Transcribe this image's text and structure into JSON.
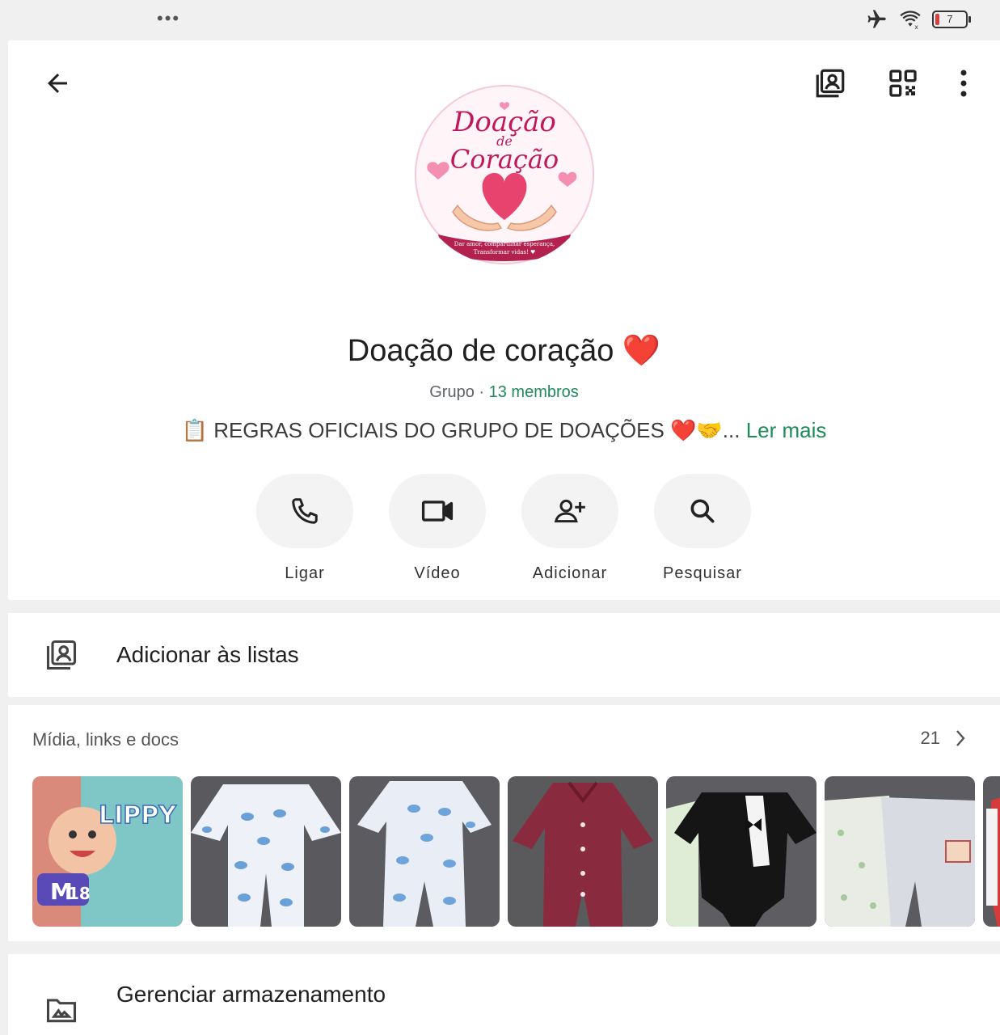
{
  "status_bar": {
    "battery_level": "7"
  },
  "group": {
    "avatar_text": {
      "line1": "Doação",
      "line2": "de",
      "line3": "Coração",
      "banner1": "Dar amor, compartilhar esperança,",
      "banner2": "Transformar vidas! ♥"
    },
    "name": "Doação de coração ❤️",
    "type_label": "Grupo",
    "separator": " · ",
    "members_label": "13 membros",
    "description_icon": "📋",
    "description": "REGRAS OFICIAIS DO GRUPO DE DOAÇÕES ❤️🤝...",
    "read_more": " Ler mais"
  },
  "actions": {
    "call": "Ligar",
    "video": "Vídeo",
    "add": "Adicionar",
    "search": "Pesquisar"
  },
  "lists": {
    "label": "Adicionar às listas"
  },
  "media": {
    "title": "Mídia, links e docs",
    "count": "21",
    "thumbs": [
      {
        "name": "thumb-diapers",
        "brand": "LIPPY",
        "size": "M",
        "qty": "18"
      },
      {
        "name": "thumb-elephant-onesie-1"
      },
      {
        "name": "thumb-elephant-onesie-2"
      },
      {
        "name": "thumb-maroon-romper"
      },
      {
        "name": "thumb-tuxedo-bodysuit"
      },
      {
        "name": "thumb-white-rompers"
      },
      {
        "name": "thumb-red-partial"
      }
    ]
  },
  "storage": {
    "label": "Gerenciar armazenamento"
  },
  "icons": {
    "back": "arrow-left-icon",
    "lists": "contact-list-icon",
    "qr": "qr-code-icon",
    "menu": "more-vertical-icon",
    "call": "phone-icon",
    "video": "video-camera-icon",
    "add": "add-person-icon",
    "search": "search-icon",
    "storage": "folder-icon",
    "chevron": "chevron-right-icon"
  },
  "colors": {
    "accent_green": "#1f8a5a",
    "action_bg": "#f3f3f3",
    "brand_pink": "#c2185b"
  }
}
